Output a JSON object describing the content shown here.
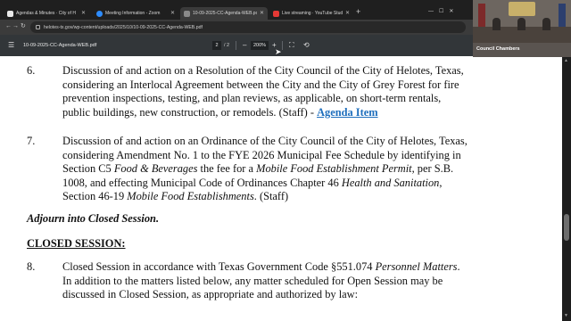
{
  "browser": {
    "tabs": [
      {
        "title": "Agendas & Minutes · City of H",
        "active": false,
        "favicon_color": "#e8e8e8"
      },
      {
        "title": "Meeting Information - Zoom",
        "active": false,
        "favicon_color": "#2d8cff"
      },
      {
        "title": "10-09-2025-CC-Agenda-WEB.pdf",
        "active": true,
        "favicon_color": "#8a8a8a"
      },
      {
        "title": "Live streaming · YouTube Stud",
        "active": false,
        "favicon_color": "#e53935"
      }
    ],
    "new_tab_glyph": "+",
    "url": "helotes-tx.gov/wp-content/uploads/2025/10/10-09-2025-CC-Agenda-WEB.pdf"
  },
  "pdf_toolbar": {
    "file_name": "10-09-2025-CC-Agenda-WEB.pdf",
    "current_page": "2",
    "page_total": "/ 2",
    "zoom": "200%",
    "zoom_out_glyph": "–",
    "zoom_in_glyph": "+"
  },
  "video": {
    "label": "Council Chambers"
  },
  "document": {
    "item6": {
      "number": "6.",
      "lines": [
        "Discussion of and action on a Resolution of the City Council of the City of Helotes, Texas,",
        "considering an Interlocal Agreement between the City and the City of Grey Forest for fire",
        "prevention inspections, testing, and plan reviews, as applicable, on short-term rentals,",
        "public buildings, new construction, or remodels. (Staff) -"
      ],
      "link_text": "Agenda Item"
    },
    "item7": {
      "number": "7.",
      "line1": "Discussion of and action on an Ordinance of the City Council of the City of Helotes, Texas,",
      "line2": "considering Amendment No. 1 to the FYE 2026 Municipal Fee Schedule by identifying in",
      "line3_a": "Section C5 ",
      "line3_em1": "Food & Beverages",
      "line3_b": " the fee for a ",
      "line3_em2": "Mobile Food Establishment Permit",
      "line3_c": ", per S.B.",
      "line4_a": "1008, and effecting Municipal Code of Ordinances Chapter 46 ",
      "line4_em": "Health and Sanitation",
      "line4_b": ",",
      "line5_a": "Section 46-19 ",
      "line5_em": "Mobile Food Establishments",
      "line5_b": ". (Staff)"
    },
    "adjourn": "Adjourn into Closed Session.",
    "closed_heading": "CLOSED SESSION:",
    "item8": {
      "number": "8.",
      "line1_a": "Closed Session in accordance with Texas Government Code §551.074 ",
      "line1_em": "Personnel Matters",
      "line1_b": ".",
      "line2": "In addition to the matters listed below, any matter scheduled for Open Session may be",
      "line3": "discussed in Closed Session, as appropriate and authorized by law:"
    }
  }
}
